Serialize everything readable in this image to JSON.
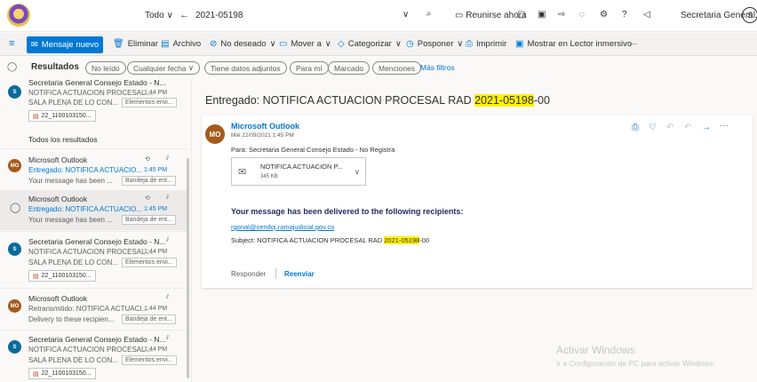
{
  "titlebar": {
    "scope": "Todo",
    "search_query": "2021-05198",
    "meet_now": "Reunirse ahora",
    "account": "Secretaria General...",
    "account_initial": "S"
  },
  "toolbar": {
    "new_mail": "Mensaje nuevo",
    "delete": "Eliminar",
    "archive": "Archivo",
    "junk": "No deseado",
    "move": "Mover a",
    "categorize": "Categorizar",
    "snooze": "Posponer",
    "print": "Imprimir",
    "immersive": "Mostrar en Lector inmersivo",
    "more": "···"
  },
  "filters": {
    "results": "Resultados",
    "unread": "No leído",
    "any_date": "Cualquier fecha",
    "attachments": "Tiene datos adjuntos",
    "to_me": "Para mí",
    "flagged": "Marcado",
    "mentions": "Menciones",
    "more": "Más filtros"
  },
  "list": {
    "top_item": {
      "from": "Secretaria General Consejo Estado - N...",
      "subject": "NOTIFICA ACTUACION PROCESAL ...",
      "time": "1:44 PM",
      "preview": "SALA PLENA DE LO CON...",
      "tag": "Elementos envi...",
      "attachment": "22_1100103150..."
    },
    "section_header": "Todos los resultados",
    "items": [
      {
        "avatar": "MO",
        "from": "Microsoft Outlook",
        "subject": "Entregado: NOTIFICA ACTUACIO...",
        "time": "1:45 PM",
        "preview": "Your message has been ...",
        "tag": "Bandeja de ent..."
      },
      {
        "avatar": "",
        "from": "Microsoft Outlook",
        "subject": "Entregado: NOTIFICA ACTUACIO...",
        "time": "1:45 PM",
        "preview": "Your message has been ...",
        "tag": "Bandeja de ent..."
      },
      {
        "avatar": "S",
        "from": "Secretaria General Consejo Estado - N...",
        "subject": "NOTIFICA ACTUACION PROCESAL ...",
        "time": "1:44 PM",
        "preview": "SALA PLENA DE LO CON...",
        "tag": "Elementos envi...",
        "attachment": "22_1100103150..."
      },
      {
        "avatar": "MO",
        "from": "Microsoft Outlook",
        "subject": "Retransmitido: NOTIFICA ACTUACI...",
        "time": "1:44 PM",
        "preview": "Delivery to these recipien...",
        "tag": "Bandeja de ent..."
      },
      {
        "avatar": "S",
        "from": "Secretaria General Consejo Estado - N...",
        "subject": "NOTIFICA ACTUACION PROCESAL ...",
        "time": "1:44 PM",
        "preview": "SALA PLENA DE LO CON...",
        "tag": "Elementos envi...",
        "attachment": "22_1100103150..."
      }
    ]
  },
  "reading": {
    "subject_prefix": "Entregado: NOTIFICA ACTUACION PROCESAL RAD ",
    "subject_highlight": "2021-05198",
    "subject_suffix": "-00",
    "sender": "Microsoft Outlook",
    "sender_initials": "MO",
    "date": "Mié 22/09/2021 1:45 PM",
    "to": "Para: Secretaria General Consejo Estado - No Registra",
    "attachment_name": "NOTIFICA ACTUACION P...",
    "attachment_size": "345 KB",
    "body_heading": "Your message has been delivered to the following recipients:",
    "recipient": "rgonal@cendoj.ramajudicial.gov.co",
    "body_subject_prefix": "Subject: NOTIFICA ACTUACION PROCESAL RAD ",
    "body_subject_highlight": "2021-05198",
    "body_subject_suffix": "-00",
    "reply": "Responder",
    "forward": "Reenviar"
  },
  "watermark": {
    "title": "Activar Windows",
    "subtitle": "Ir a Configuración de PC para activar Windows."
  },
  "colors": {
    "accent": "#0078d4",
    "highlight": "#fff100"
  }
}
